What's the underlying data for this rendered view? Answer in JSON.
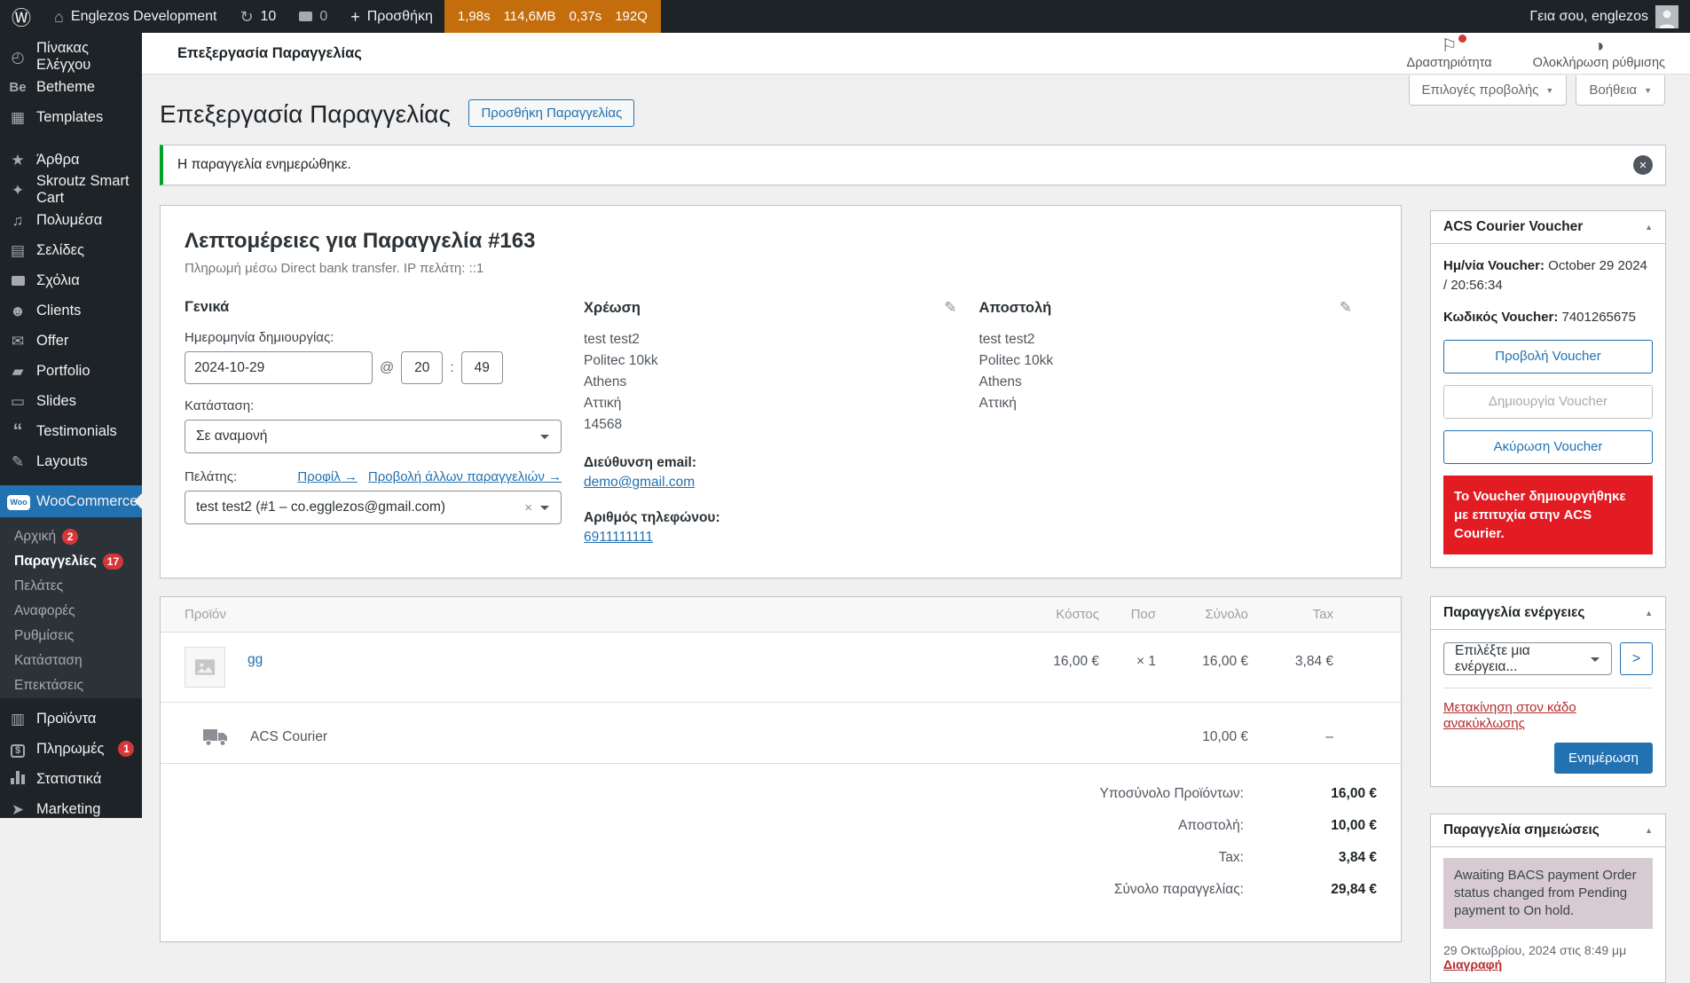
{
  "admin_bar": {
    "site_name": "Englezos Development",
    "updates_count": "10",
    "comments_count": "0",
    "new_label": "Προσθήκη",
    "perf": {
      "time": "1,98s",
      "memory": "114,6MB",
      "db_time": "0,37s",
      "queries": "192Q"
    },
    "greeting": "Γεια σου, englezos"
  },
  "sidebar": {
    "items_top": [
      {
        "label": "Πίνακας Ελέγχου"
      },
      {
        "label": "Betheme"
      },
      {
        "label": "Templates"
      },
      {
        "label": "Άρθρα"
      },
      {
        "label": "Skroutz Smart Cart"
      },
      {
        "label": "Πολυμέσα"
      },
      {
        "label": "Σελίδες"
      },
      {
        "label": "Σχόλια"
      },
      {
        "label": "Clients"
      },
      {
        "label": "Offer"
      },
      {
        "label": "Portfolio"
      },
      {
        "label": "Slides"
      },
      {
        "label": "Testimonials"
      },
      {
        "label": "Layouts"
      }
    ],
    "woocommerce": {
      "label": "WooCommerce"
    },
    "woo_submenu": [
      {
        "label": "Αρχική",
        "badge": "2"
      },
      {
        "label": "Παραγγελίες",
        "badge": "17"
      },
      {
        "label": "Πελάτες",
        "badge": ""
      },
      {
        "label": "Αναφορές",
        "badge": ""
      },
      {
        "label": "Ρυθμίσεις",
        "badge": ""
      },
      {
        "label": "Κατάσταση",
        "badge": ""
      },
      {
        "label": "Επεκτάσεις",
        "badge": ""
      }
    ],
    "items_bottom": [
      {
        "label": "Προϊόντα",
        "badge": ""
      },
      {
        "label": "Πληρωμές",
        "badge": "1"
      },
      {
        "label": "Στατιστικά",
        "badge": ""
      },
      {
        "label": "Marketing",
        "badge": ""
      }
    ]
  },
  "header": {
    "toolbar_title": "Επεξεργασία Παραγγελίας",
    "activity_label": "Δραστηριότητα",
    "setup_label": "Ολοκλήρωση ρύθμισης",
    "screen_options_label": "Επιλογές προβολής",
    "help_label": "Βοήθεια"
  },
  "page": {
    "title": "Επεξεργασία Παραγγελίας",
    "add_order_button": "Προσθήκη Παραγγελίας",
    "notice": "Η παραγγελία ενημερώθηκε."
  },
  "order": {
    "heading": "Λεπτομέρειες για Παραγγελία #163",
    "subheading": "Πληρωμή μέσω Direct bank transfer. IP πελάτη: ::1",
    "general": {
      "heading": "Γενικά",
      "date_label": "Ημερομηνία δημιουργίας:",
      "date_value": "2024-10-29",
      "at_symbol": "@",
      "hour": "20",
      "time_sep": ":",
      "minute": "49",
      "status_label": "Κατάσταση:",
      "status_value": "Σε αναμονή",
      "customer_label": "Πελάτης:",
      "profile_link": "Προφίλ →",
      "other_orders_link": "Προβολή άλλων παραγγελιών →",
      "customer_value": "test test2 (#1 – co.egglezos@gmail.com)"
    },
    "billing": {
      "heading": "Χρέωση",
      "address": [
        "test test2",
        "Politec 10kk",
        "Athens",
        "Αττική",
        "14568"
      ],
      "email_label": "Διεύθυνση email:",
      "email": "demo@gmail.com",
      "phone_label": "Αριθμός τηλεφώνου:",
      "phone": "6911111111"
    },
    "shipping": {
      "heading": "Αποστολή",
      "address": [
        "test test2",
        "Politec 10kk",
        "Athens",
        "Αττική"
      ]
    }
  },
  "items": {
    "columns": {
      "product": "Προϊόν",
      "cost": "Κόστος",
      "qty": "Ποσ",
      "total": "Σύνολο",
      "tax": "Tax"
    },
    "products": [
      {
        "name": "gg",
        "cost": "16,00 €",
        "qty": "× 1",
        "total": "16,00 €",
        "tax": "3,84 €"
      }
    ],
    "shipping_rows": [
      {
        "name": "ACS Courier",
        "total": "10,00 €",
        "tax": "–"
      }
    ],
    "totals": [
      {
        "label": "Υποσύνολο Προϊόντων:",
        "value": "16,00 €"
      },
      {
        "label": "Αποστολή:",
        "value": "10,00 €"
      },
      {
        "label": "Tax:",
        "value": "3,84 €"
      },
      {
        "label": "Σύνολο παραγγελίας:",
        "value": "29,84 €"
      }
    ]
  },
  "voucher": {
    "title": "ACS Courier Voucher",
    "date_label": "Ημ/νία Voucher:",
    "date_value": "October 29 2024 / 20:56:34",
    "code_label": "Κωδικός Voucher:",
    "code_value": "7401265675",
    "view_button": "Προβολή Voucher",
    "create_button": "Δημιουργία Voucher",
    "cancel_button": "Ακύρωση Voucher",
    "success_message": "Το Voucher δημιουργήθηκε με επιτυχία στην ACS Courier."
  },
  "actions": {
    "title": "Παραγγελία ενέργειες",
    "select_placeholder": "Επιλέξτε μια ενέργεια...",
    "go_label": ">",
    "trash_link": "Μετακίνηση στον κάδο ανακύκλωσης",
    "update_button": "Ενημέρωση"
  },
  "notes": {
    "title": "Παραγγελία σημειώσεις",
    "entries": [
      {
        "text": "Awaiting BACS payment Order status changed from Pending payment to On hold.",
        "meta": "29 Οκτωβρίου, 2024 στις 8:49 μμ ",
        "delete_label": "Διαγραφή"
      }
    ]
  },
  "colors": {
    "accent": "#2271b1",
    "admin_dark": "#1d2327",
    "badge_red": "#d63638",
    "notice_green": "#00a32a",
    "alert_red": "#e31b23",
    "perf_badge_orange": "#c36d0c",
    "note_bubble": "#d7cad2",
    "trash_red": "#b32d2e",
    "content_bg": "#f0f0f1"
  },
  "icons": {
    "wp_logo": "Ⓦ",
    "home": "⌂",
    "updates": "↻",
    "plus": "+",
    "dashboard": "◴",
    "betheme": "Be",
    "templates": "▦",
    "posts": "★",
    "skroutz": "✦",
    "media": "♫",
    "pages": "▤",
    "clients": "☻",
    "offer": "✉",
    "portfolio": "▰",
    "slides": "▭",
    "testimonials": "“",
    "layouts": "✎",
    "products": "▥",
    "marketing": "➤",
    "flag": "⚐",
    "contrast": "◑",
    "pencil": "✎",
    "collapse": "▲",
    "dropdown": "▼",
    "close": "✕",
    "remove": "×"
  }
}
